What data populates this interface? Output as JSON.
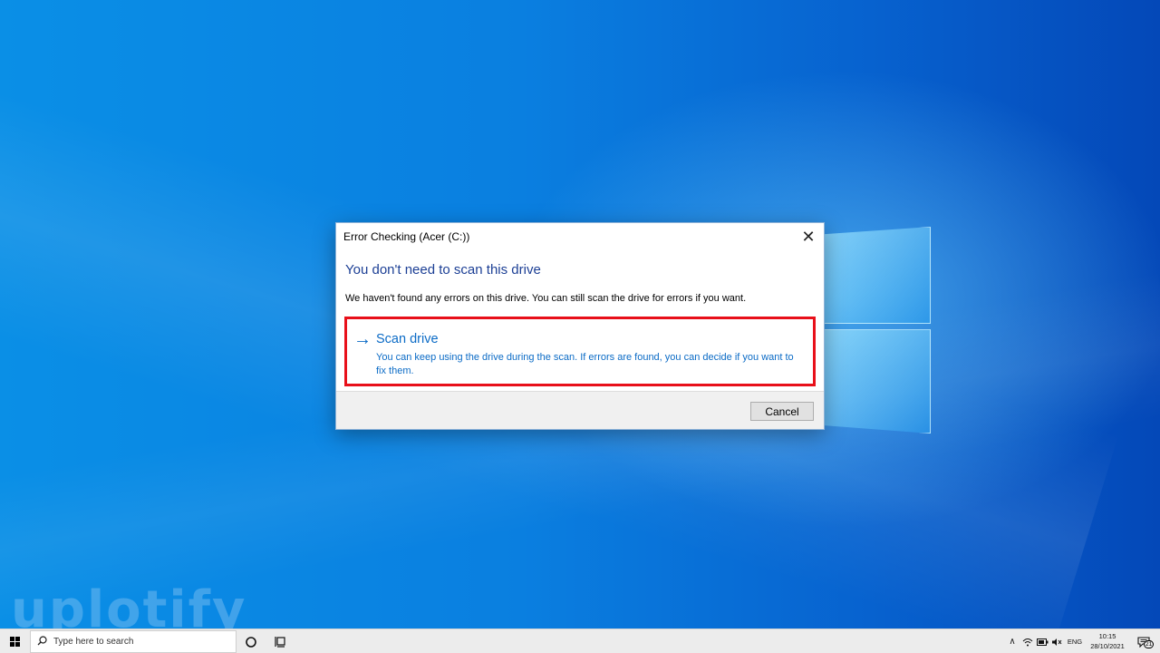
{
  "dialog": {
    "title": "Error Checking (Acer (C:))",
    "close_symbol": "✕",
    "heading": "You don't need to scan this drive",
    "description": "We haven't found any errors on this drive. You can still scan the drive for errors if you want.",
    "scan_option": {
      "arrow": "→",
      "title": "Scan drive",
      "description": "You can keep using the drive during the scan. If errors are found, you can decide if you want to fix them.",
      "highlight_color": "#e8101a"
    },
    "cancel_label": "Cancel"
  },
  "taskbar": {
    "search_placeholder": "Type here to search",
    "language": "ENG",
    "time": "10:15",
    "date": "28/10/2021",
    "notification_count": "21"
  },
  "watermark": {
    "text": "uplotify"
  },
  "colors": {
    "accent_text": "#0b6bc6",
    "heading": "#1c3f95",
    "desktop": "#0a7fe0"
  }
}
